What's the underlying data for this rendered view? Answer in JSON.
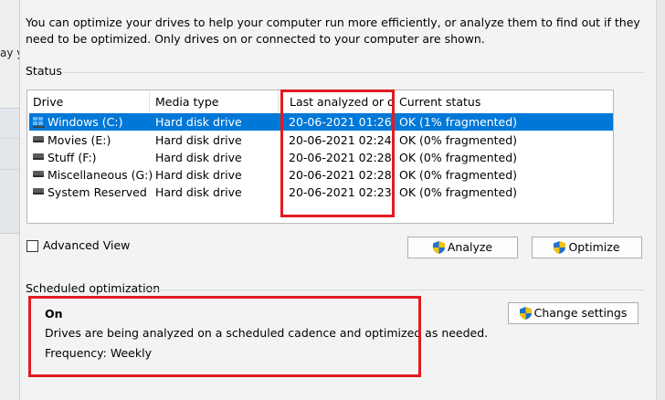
{
  "outer": {
    "left_fragment": "ay yo"
  },
  "intro_text": "You can optimize your drives to help your computer run more efficiently, or analyze them to find out if they need to be optimized. Only drives on or connected to your computer are shown.",
  "status": {
    "label": "Status",
    "columns": [
      "Drive",
      "Media type",
      "Last analyzed or o...",
      "Current status"
    ],
    "drives": [
      {
        "name": "Windows (C:)",
        "media": "Hard disk drive",
        "last": "20-06-2021 01:26",
        "status": "OK (1% fragmented)",
        "icon": "windows-drive-icon",
        "selected": true
      },
      {
        "name": "Movies (E:)",
        "media": "Hard disk drive",
        "last": "20-06-2021 02:24",
        "status": "OK (0% fragmented)",
        "icon": "hard-drive-icon",
        "selected": false
      },
      {
        "name": "Stuff (F:)",
        "media": "Hard disk drive",
        "last": "20-06-2021 02:28",
        "status": "OK (0% fragmented)",
        "icon": "hard-drive-icon",
        "selected": false
      },
      {
        "name": "Miscellaneous (G:)",
        "media": "Hard disk drive",
        "last": "20-06-2021 02:28",
        "status": "OK (0% fragmented)",
        "icon": "hard-drive-icon",
        "selected": false
      },
      {
        "name": "System Reserved",
        "media": "Hard disk drive",
        "last": "20-06-2021 02:23",
        "status": "OK (0% fragmented)",
        "icon": "hard-drive-icon",
        "selected": false
      }
    ]
  },
  "advanced_view": {
    "label": "Advanced View",
    "checked": false
  },
  "buttons": {
    "analyze": "Analyze",
    "optimize": "Optimize",
    "change_settings": "Change settings"
  },
  "scheduled": {
    "label": "Scheduled optimization",
    "state": "On",
    "description": "Drives are being analyzed on a scheduled cadence and optimized as needed.",
    "frequency": "Frequency: Weekly"
  },
  "colors": {
    "selection": "#0078d7",
    "highlight": "#e11b22",
    "shield_blue": "#1f6fd6",
    "shield_yellow": "#f2c200"
  }
}
